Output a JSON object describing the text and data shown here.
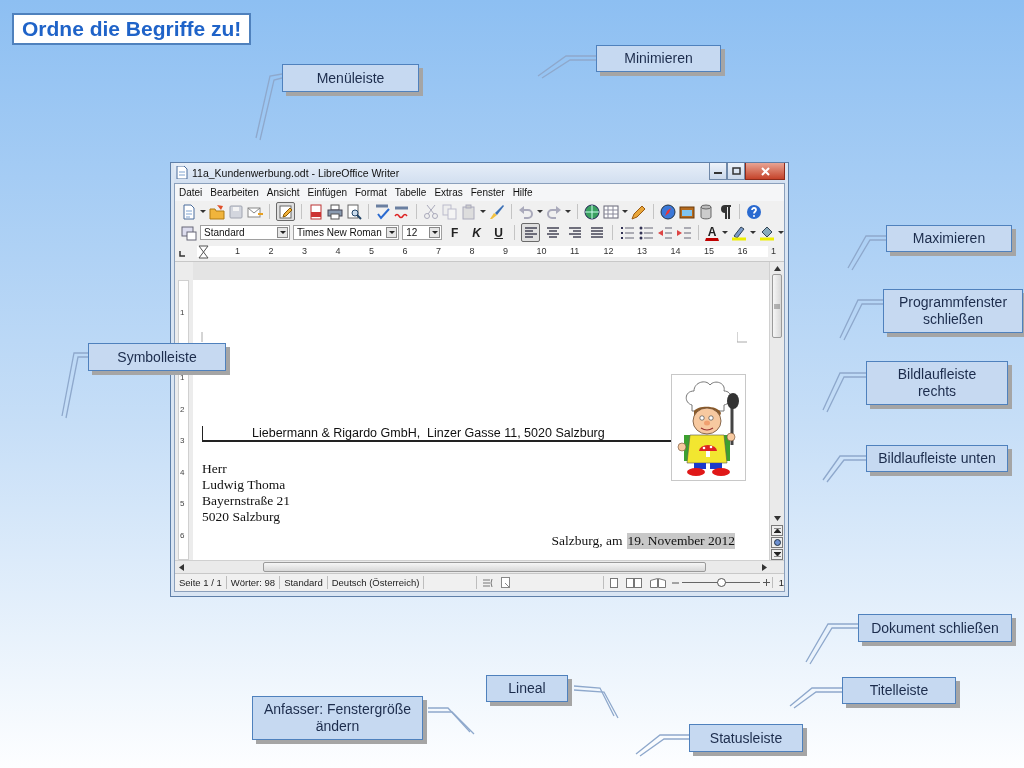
{
  "slide_title": "Ordne die Begriffe zu!",
  "window": {
    "title": "11a_Kundenwerbung.odt - LibreOffice Writer",
    "menu": [
      {
        "label": "Datei"
      },
      {
        "label": "Bearbeiten"
      },
      {
        "label": "Ansicht"
      },
      {
        "label": "Einfügen"
      },
      {
        "label": "Format"
      },
      {
        "label": "Tabelle"
      },
      {
        "label": "Extras"
      },
      {
        "label": "Fenster"
      },
      {
        "label": "Hilfe"
      }
    ],
    "edit_mode": {
      "on": true
    },
    "style_box": {
      "value": "Standard"
    },
    "font_box": {
      "value": "Times New Roman"
    },
    "size_box": {
      "value": "12"
    },
    "char_buttons": [
      {
        "label": "F"
      },
      {
        "label": "K"
      },
      {
        "label": "U"
      }
    ],
    "align_buttons": [
      {
        "kind": "left",
        "selected": true
      },
      {
        "kind": "center",
        "selected": false
      },
      {
        "kind": "right",
        "selected": false
      },
      {
        "kind": "justify",
        "selected": false
      }
    ],
    "font_color_letter": "A",
    "ruler_marks": [
      "1",
      "2",
      "3",
      "4",
      "5",
      "6",
      "7",
      "8",
      "9",
      "10",
      "11",
      "12",
      "13",
      "14",
      "15",
      "16",
      "1"
    ],
    "vertical_ruler_marks": [
      "1",
      "1",
      "2",
      "3",
      "4",
      "5",
      "6"
    ],
    "document": {
      "letterhead": "Liebermann & Rigardo GmbH,  Linzer Gasse 11, 5020 Salzburg",
      "address": [
        "Herr",
        "Ludwig Thoma",
        "Bayernstraße 21",
        "5020 Salzburg"
      ],
      "place": "Salzburg, am",
      "date": "19. November 2012"
    },
    "status_bar": {
      "fields": [
        "Seite 1 / 1",
        "Wörter: 98",
        "Standard",
        "Deutsch (Österreich)"
      ],
      "zoom": {
        "level": 0.5
      },
      "zoom_reading": "1"
    }
  },
  "callouts": [
    {
      "text": "Minimieren"
    },
    {
      "text": "Menüleiste"
    },
    {
      "text": "Maximieren"
    },
    {
      "text": "Programmfenster schließen"
    },
    {
      "text": "Symbolleiste"
    },
    {
      "text": "Bildlaufleiste rechts"
    },
    {
      "text": "Bildlaufleiste unten"
    },
    {
      "text": "Dokument schließen"
    },
    {
      "text": "Lineal"
    },
    {
      "text": "Titelleiste"
    },
    {
      "text": "Anfasser: Fenstergröße ändern"
    },
    {
      "text": "Statusleiste"
    }
  ]
}
